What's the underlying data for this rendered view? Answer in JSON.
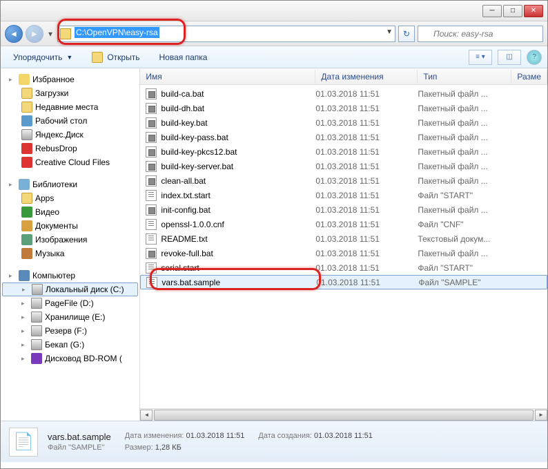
{
  "address_path": "C:\\OpenVPN\\easy-rsa",
  "search_placeholder": "Поиск: easy-rsa",
  "toolbar": {
    "organize": "Упорядочить",
    "open": "Открыть",
    "new_folder": "Новая папка"
  },
  "columns": {
    "name": "Имя",
    "date": "Дата изменения",
    "type": "Тип",
    "size": "Разме"
  },
  "sidebar": {
    "favorites": "Избранное",
    "downloads": "Загрузки",
    "recent": "Недавние места",
    "desktop": "Рабочий стол",
    "yandex": "Яндекс.Диск",
    "rebus": "RebusDrop",
    "creative": "Creative Cloud Files",
    "libraries": "Библиотеки",
    "apps": "Apps",
    "video": "Видео",
    "documents": "Документы",
    "images": "Изображения",
    "music": "Музыка",
    "computer": "Компьютер",
    "local_c": "Локальный диск (C:)",
    "pagefile": "PageFile (D:)",
    "storage": "Хранилище (E:)",
    "reserve": "Резерв (F:)",
    "bekap": "Бекап (G:)",
    "bdrom": "Дисковод BD-ROM ("
  },
  "files": [
    {
      "name": "build-ca.bat",
      "date": "01.03.2018 11:51",
      "type": "Пакетный файл ...",
      "icon": "bat"
    },
    {
      "name": "build-dh.bat",
      "date": "01.03.2018 11:51",
      "type": "Пакетный файл ...",
      "icon": "bat"
    },
    {
      "name": "build-key.bat",
      "date": "01.03.2018 11:51",
      "type": "Пакетный файл ...",
      "icon": "bat"
    },
    {
      "name": "build-key-pass.bat",
      "date": "01.03.2018 11:51",
      "type": "Пакетный файл ...",
      "icon": "bat"
    },
    {
      "name": "build-key-pkcs12.bat",
      "date": "01.03.2018 11:51",
      "type": "Пакетный файл ...",
      "icon": "bat"
    },
    {
      "name": "build-key-server.bat",
      "date": "01.03.2018 11:51",
      "type": "Пакетный файл ...",
      "icon": "bat"
    },
    {
      "name": "clean-all.bat",
      "date": "01.03.2018 11:51",
      "type": "Пакетный файл ...",
      "icon": "bat"
    },
    {
      "name": "index.txt.start",
      "date": "01.03.2018 11:51",
      "type": "Файл \"START\"",
      "icon": "txt"
    },
    {
      "name": "init-config.bat",
      "date": "01.03.2018 11:51",
      "type": "Пакетный файл ...",
      "icon": "bat"
    },
    {
      "name": "openssl-1.0.0.cnf",
      "date": "01.03.2018 11:51",
      "type": "Файл \"CNF\"",
      "icon": "txt"
    },
    {
      "name": "README.txt",
      "date": "01.03.2018 11:51",
      "type": "Текстовый докум...",
      "icon": "txt"
    },
    {
      "name": "revoke-full.bat",
      "date": "01.03.2018 11:51",
      "type": "Пакетный файл ...",
      "icon": "bat"
    },
    {
      "name": "serial.start",
      "date": "01.03.2018 11:51",
      "type": "Файл \"START\"",
      "icon": "txt"
    },
    {
      "name": "vars.bat.sample",
      "date": "01.03.2018 11:51",
      "type": "Файл \"SAMPLE\"",
      "icon": "txt",
      "selected": true
    }
  ],
  "status": {
    "filename": "vars.bat.sample",
    "date_mod_label": "Дата изменения:",
    "date_mod": "01.03.2018 11:51",
    "date_created_label": "Дата создания:",
    "date_created": "01.03.2018 11:51",
    "filetype": "Файл \"SAMPLE\"",
    "size_label": "Размер:",
    "size": "1,28 КБ"
  }
}
